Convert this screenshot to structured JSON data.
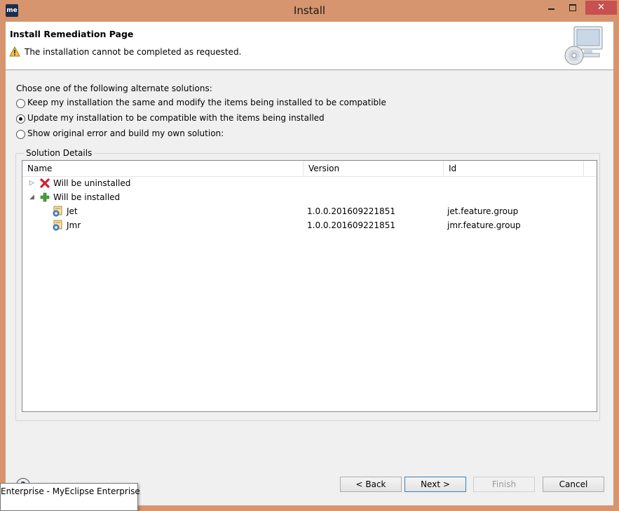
{
  "window": {
    "app_icon_text": "me",
    "title": "Install",
    "min_symbol": "",
    "close_symbol": "✕"
  },
  "header": {
    "title": "Install Remediation Page",
    "message": "The installation cannot be completed as requested."
  },
  "options": {
    "prompt": "Chose one of the following alternate solutions:",
    "items": [
      {
        "label": "Keep my installation the same and modify the items being installed to be compatible",
        "checked": false
      },
      {
        "label": "Update my installation to be compatible with the items being installed",
        "checked": true
      },
      {
        "label": "Show original error and build my own solution:",
        "checked": false
      }
    ]
  },
  "solution_details": {
    "group_label": "Solution Details",
    "columns": [
      "Name",
      "Version",
      "Id"
    ],
    "rows": [
      {
        "name": "Will be uninstalled",
        "version": "",
        "id": "",
        "level": 0,
        "expanded": false,
        "icon": "red-x-icon"
      },
      {
        "name": "Will be installed",
        "version": "",
        "id": "",
        "level": 0,
        "expanded": true,
        "icon": "green-plus-icon"
      },
      {
        "name": "Jet",
        "version": "1.0.0.201609221851",
        "id": "jet.feature.group",
        "level": 1,
        "icon": "feature-icon"
      },
      {
        "name": "Jmr",
        "version": "1.0.0.201609221851",
        "id": "jmr.feature.group",
        "level": 1,
        "icon": "feature-icon"
      }
    ]
  },
  "buttons": {
    "back": "< Back",
    "next": "Next >",
    "finish": "Finish",
    "cancel": "Cancel",
    "help": "?"
  },
  "tooltip": {
    "text": "Enterprise - MyEclipse Enterprise"
  },
  "colors": {
    "window_frame": "#d6956e",
    "close_button": "#c75050",
    "default_button_border": "#3c7fb1"
  }
}
